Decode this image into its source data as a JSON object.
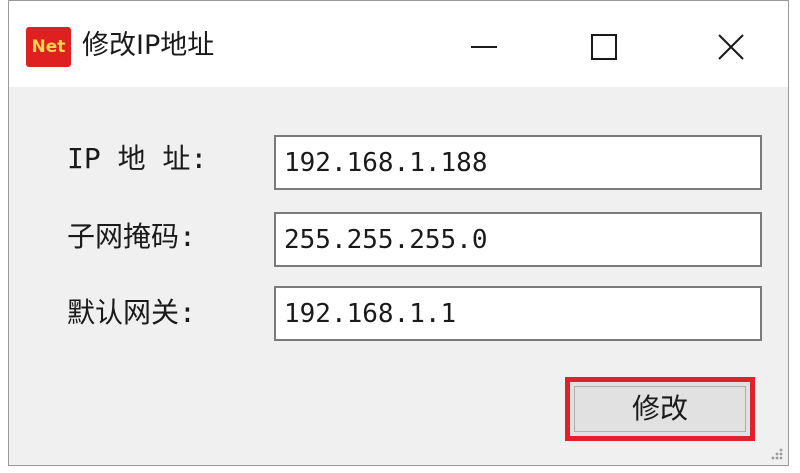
{
  "window": {
    "app_icon_text": "Net",
    "title": "修改IP地址",
    "icons": {
      "minimize": "minimize-icon",
      "maximize": "maximize-icon",
      "close": "close-icon"
    }
  },
  "form": {
    "ip": {
      "label": "IP 地 址:",
      "value": "192.168.1.188"
    },
    "mask": {
      "label": "子网掩码:",
      "value": "255.255.255.0"
    },
    "gateway": {
      "label": "默认网关:",
      "value": "192.168.1.1"
    },
    "submit_label": "修改"
  },
  "colors": {
    "icon_background": "#e02020",
    "highlight_border": "#e0202a",
    "window_background": "#f0f0f0"
  }
}
